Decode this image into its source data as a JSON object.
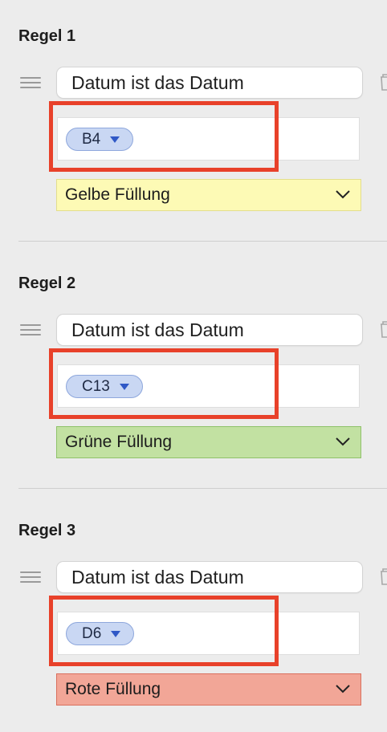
{
  "rules": [
    {
      "title": "Regel 1",
      "condition": "Datum ist das Datum",
      "cell_ref": "B4",
      "fill": {
        "label": "Gelbe Füllung",
        "bg": "#fdfab5",
        "border": "#e3de8c"
      }
    },
    {
      "title": "Regel 2",
      "condition": "Datum ist das Datum",
      "cell_ref": "C13",
      "fill": {
        "label": "Grüne Füllung",
        "bg": "#c2e1a2",
        "border": "#8fc26a"
      }
    },
    {
      "title": "Regel 3",
      "condition": "Datum ist das Datum",
      "cell_ref": "D6",
      "fill": {
        "label": "Rote Füllung",
        "bg": "#f2a697",
        "border": "#d9705d"
      }
    }
  ],
  "colors": {
    "highlight": "#e8412a",
    "token_bg": "#c9d7f3",
    "panel_bg": "#ececec"
  },
  "icons": [
    "drag-handle-icon",
    "trash-icon",
    "dropdown-caret-icon",
    "chevron-down-icon"
  ]
}
